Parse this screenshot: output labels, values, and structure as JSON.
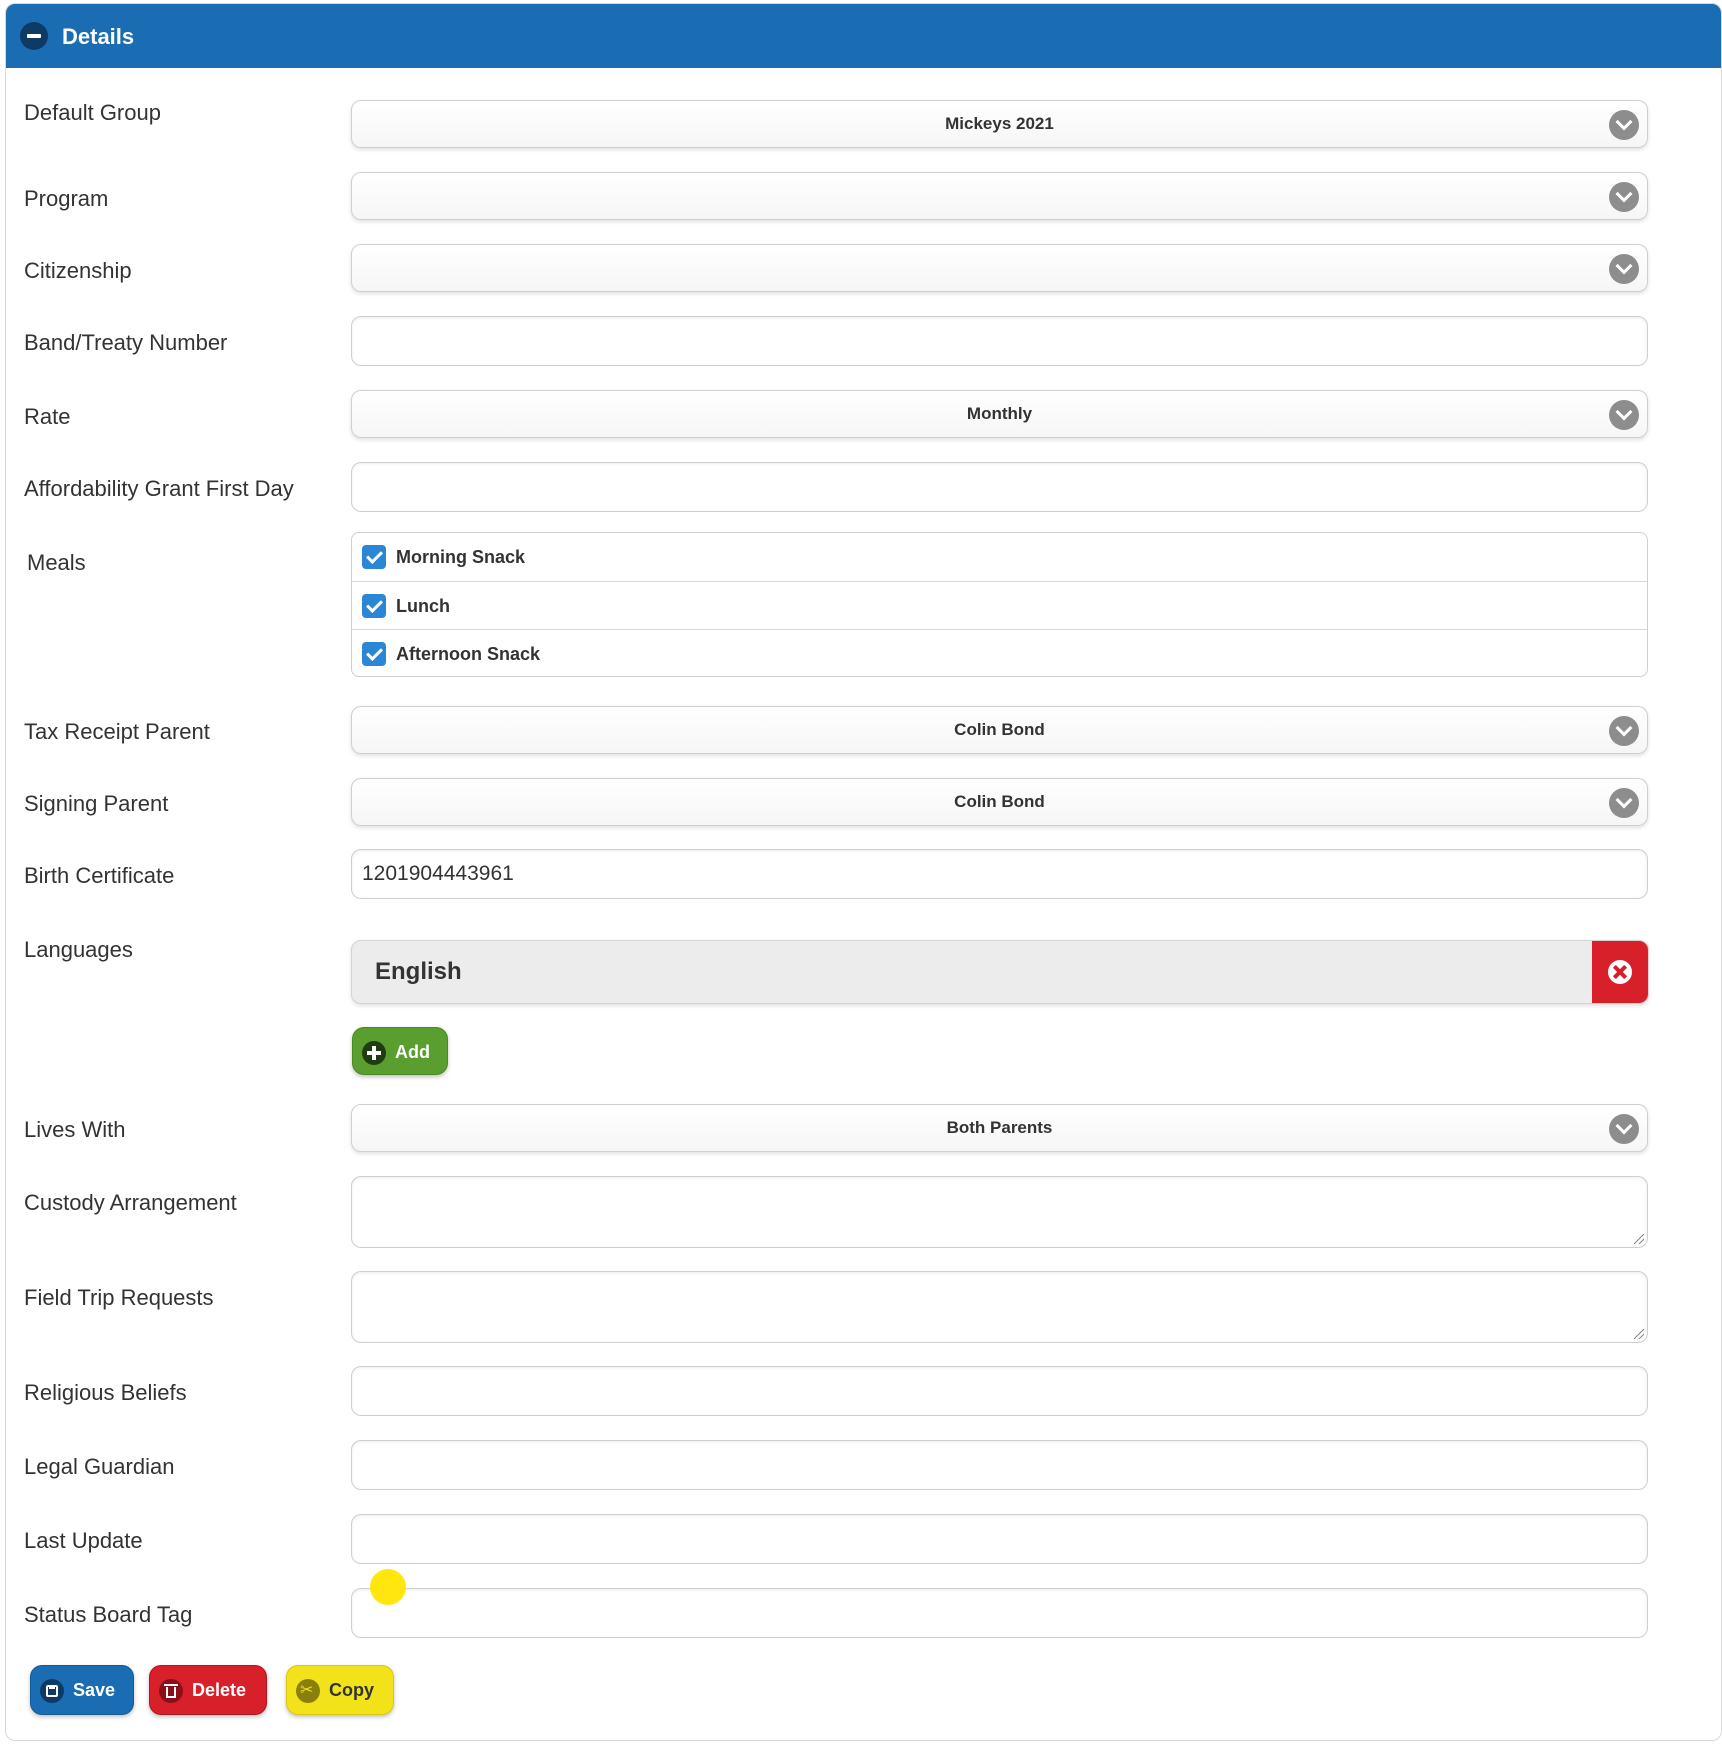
{
  "panel": {
    "title": "Details"
  },
  "fields": {
    "default_group": {
      "label": "Default Group",
      "value": "Mickeys 2021"
    },
    "program": {
      "label": "Program",
      "value": ""
    },
    "citizenship": {
      "label": "Citizenship",
      "value": ""
    },
    "band_treaty": {
      "label": "Band/Treaty Number",
      "value": ""
    },
    "rate": {
      "label": "Rate",
      "value": "Monthly"
    },
    "affordability": {
      "label": "Affordability Grant First Day",
      "value": ""
    },
    "meals": {
      "label": "Meals",
      "options": [
        {
          "label": "Morning Snack",
          "checked": true
        },
        {
          "label": "Lunch",
          "checked": true
        },
        {
          "label": "Afternoon Snack",
          "checked": true
        }
      ]
    },
    "tax_receipt_parent": {
      "label": "Tax Receipt Parent",
      "value": "Colin Bond"
    },
    "signing_parent": {
      "label": "Signing Parent",
      "value": "Colin Bond"
    },
    "birth_certificate": {
      "label": "Birth Certificate",
      "value": "1201904443961"
    },
    "languages": {
      "label": "Languages",
      "items": [
        "English"
      ],
      "add_label": "Add"
    },
    "lives_with": {
      "label": "Lives With",
      "value": "Both Parents"
    },
    "custody": {
      "label": "Custody Arrangement",
      "value": ""
    },
    "field_trip": {
      "label": "Field Trip Requests",
      "value": ""
    },
    "religious": {
      "label": "Religious Beliefs",
      "value": ""
    },
    "legal_guardian": {
      "label": "Legal Guardian",
      "value": ""
    },
    "last_update": {
      "label": "Last Update",
      "value": ""
    },
    "status_board": {
      "label": "Status Board Tag",
      "value": ""
    }
  },
  "actions": {
    "save_label": "Save",
    "delete_label": "Delete",
    "copy_label": "Copy"
  },
  "colors": {
    "header": "#1b6db3",
    "add": "#5a9e2f",
    "delete": "#d7202a",
    "copy": "#f2e21a",
    "checkbox": "#2c86d6"
  }
}
